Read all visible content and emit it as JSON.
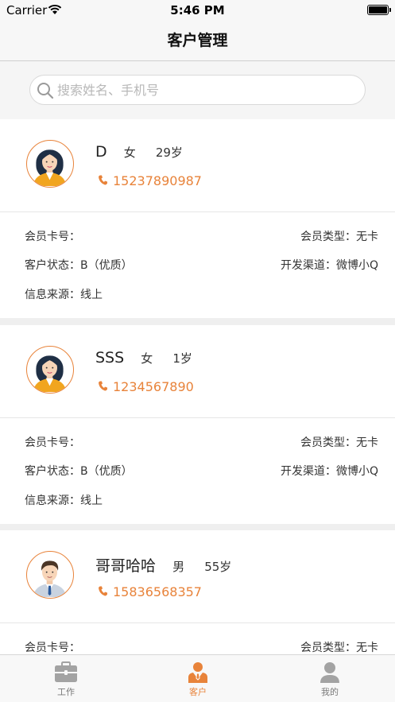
{
  "status_bar": {
    "carrier": "Carrier",
    "time": "5:46 PM"
  },
  "nav": {
    "title": "客户管理"
  },
  "search": {
    "placeholder": "搜索姓名、手机号",
    "value": ""
  },
  "colors": {
    "accent": "#e8833a",
    "tab_inactive": "#9a9a9a"
  },
  "labels": {
    "card_no": "会员卡号：",
    "member_type": "会员类型：",
    "status": "客户状态：",
    "channel": "开发渠道：",
    "source": "信息来源："
  },
  "customers": [
    {
      "name": "D",
      "gender": "女",
      "age": "29岁",
      "phone": "15237890987",
      "avatar": "female-avatar",
      "card_no": "",
      "member_type": "无卡",
      "status": "B（优质）",
      "channel": "微博小Q",
      "source": "线上"
    },
    {
      "name": "SSS",
      "gender": "女",
      "age": "1岁",
      "phone": "1234567890",
      "avatar": "female-avatar",
      "card_no": "",
      "member_type": "无卡",
      "status": "B（优质）",
      "channel": "微博小Q",
      "source": "线上"
    },
    {
      "name": "哥哥哈哈",
      "gender": "男",
      "age": "55岁",
      "phone": "15836568357",
      "avatar": "male-avatar",
      "card_no": "",
      "member_type": "无卡"
    }
  ],
  "tabs": [
    {
      "label": "工作",
      "icon": "briefcase-icon",
      "active": false
    },
    {
      "label": "客户",
      "icon": "customer-icon",
      "active": true
    },
    {
      "label": "我的",
      "icon": "person-icon",
      "active": false
    }
  ]
}
